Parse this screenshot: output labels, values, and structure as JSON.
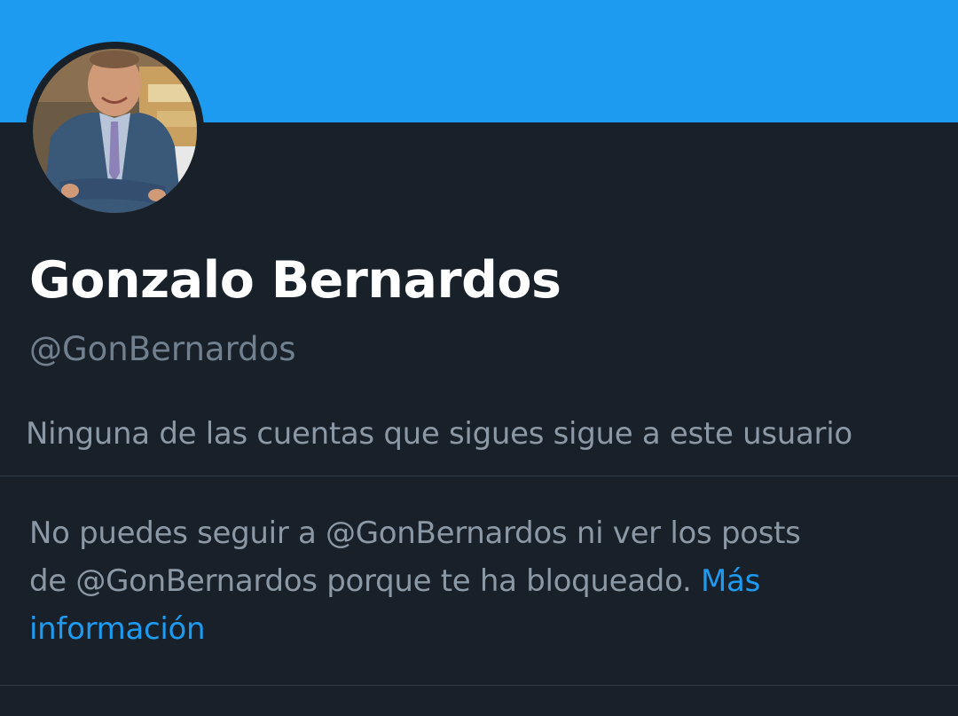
{
  "profile": {
    "display_name": "Gonzalo Bernardos",
    "handle": "@GonBernardos",
    "follow_context": "Ninguna de las cuentas que sigues sigue a este usuario"
  },
  "blocked": {
    "line1": "No puedes seguir a @GonBernardos ni ver los posts",
    "line2": "de @GonBernardos porque te ha bloqueado.",
    "link_label_1": "Más",
    "link_label_2": "información"
  },
  "colors": {
    "banner": "#1d9bf0",
    "background": "#18202a",
    "link": "#1d9bf0"
  }
}
